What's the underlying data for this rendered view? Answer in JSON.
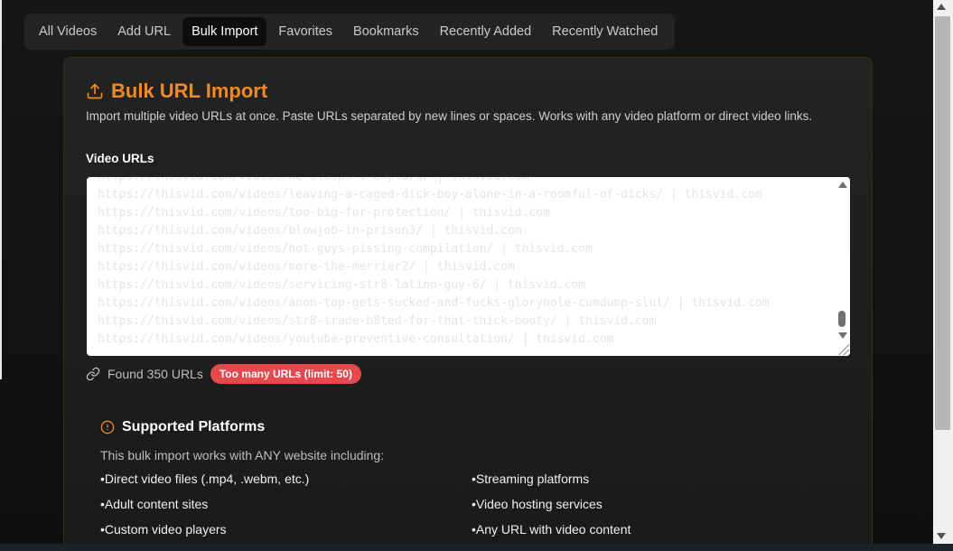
{
  "tabs": [
    {
      "label": "All Videos",
      "active": false
    },
    {
      "label": "Add URL",
      "active": false
    },
    {
      "label": "Bulk Import",
      "active": true
    },
    {
      "label": "Favorites",
      "active": false
    },
    {
      "label": "Bookmarks",
      "active": false
    },
    {
      "label": "Recently Added",
      "active": false
    },
    {
      "label": "Recently Watched",
      "active": false
    }
  ],
  "card": {
    "title": "Bulk URL Import",
    "title_icon": "upload-icon",
    "subtitle": "Import multiple video URLs at once. Paste URLs separated by new lines or spaces. Works with any video platform or direct video links.",
    "field_label": "Video URLs",
    "textarea_lines": [
      "https://thisvid.com/videos/he-sleeps-i-explore/ | thisvid.com",
      "https://thisvid.com/videos/leaving-a-caged-dick-boy-alone-in-a-roomful-of-dicks/ | thisvid.com",
      "https://thisvid.com/videos/too-big-for-protection/ | thisvid.com",
      "https://thisvid.com/videos/blowjob-in-prison3/ | thisvid.com",
      "https://thisvid.com/videos/hot-guys-pissing-compilation/ | thisvid.com",
      "https://thisvid.com/videos/more-the-merrier2/ | thisvid.com",
      "https://thisvid.com/videos/servicing-str8-latino-guy-6/ | thisvid.com",
      "https://thisvid.com/videos/anon-top-gets-sucked-and-fucks-gloryhole-cumdump-slut/ | thisvid.com",
      "https://thisvid.com/videos/str8-trade-b8ted-for-that-thick-booty/ | thisvid.com",
      "https://thisvid.com/videos/youtube-preventive-consultation/ | thisvid.com"
    ],
    "found_text": "Found 350 URLs",
    "badge_text": "Too many URLs (limit: 50)",
    "colors": {
      "accent": "#f08a24",
      "badge": "#e5484d"
    }
  },
  "platforms": {
    "heading": "Supported Platforms",
    "description": "This bulk import works with ANY website including:",
    "items": [
      "Direct video files (.mp4, .webm, etc.)",
      "Streaming platforms",
      "Adult content sites",
      "Video hosting services",
      "Custom video players",
      "Any URL with video content"
    ]
  }
}
